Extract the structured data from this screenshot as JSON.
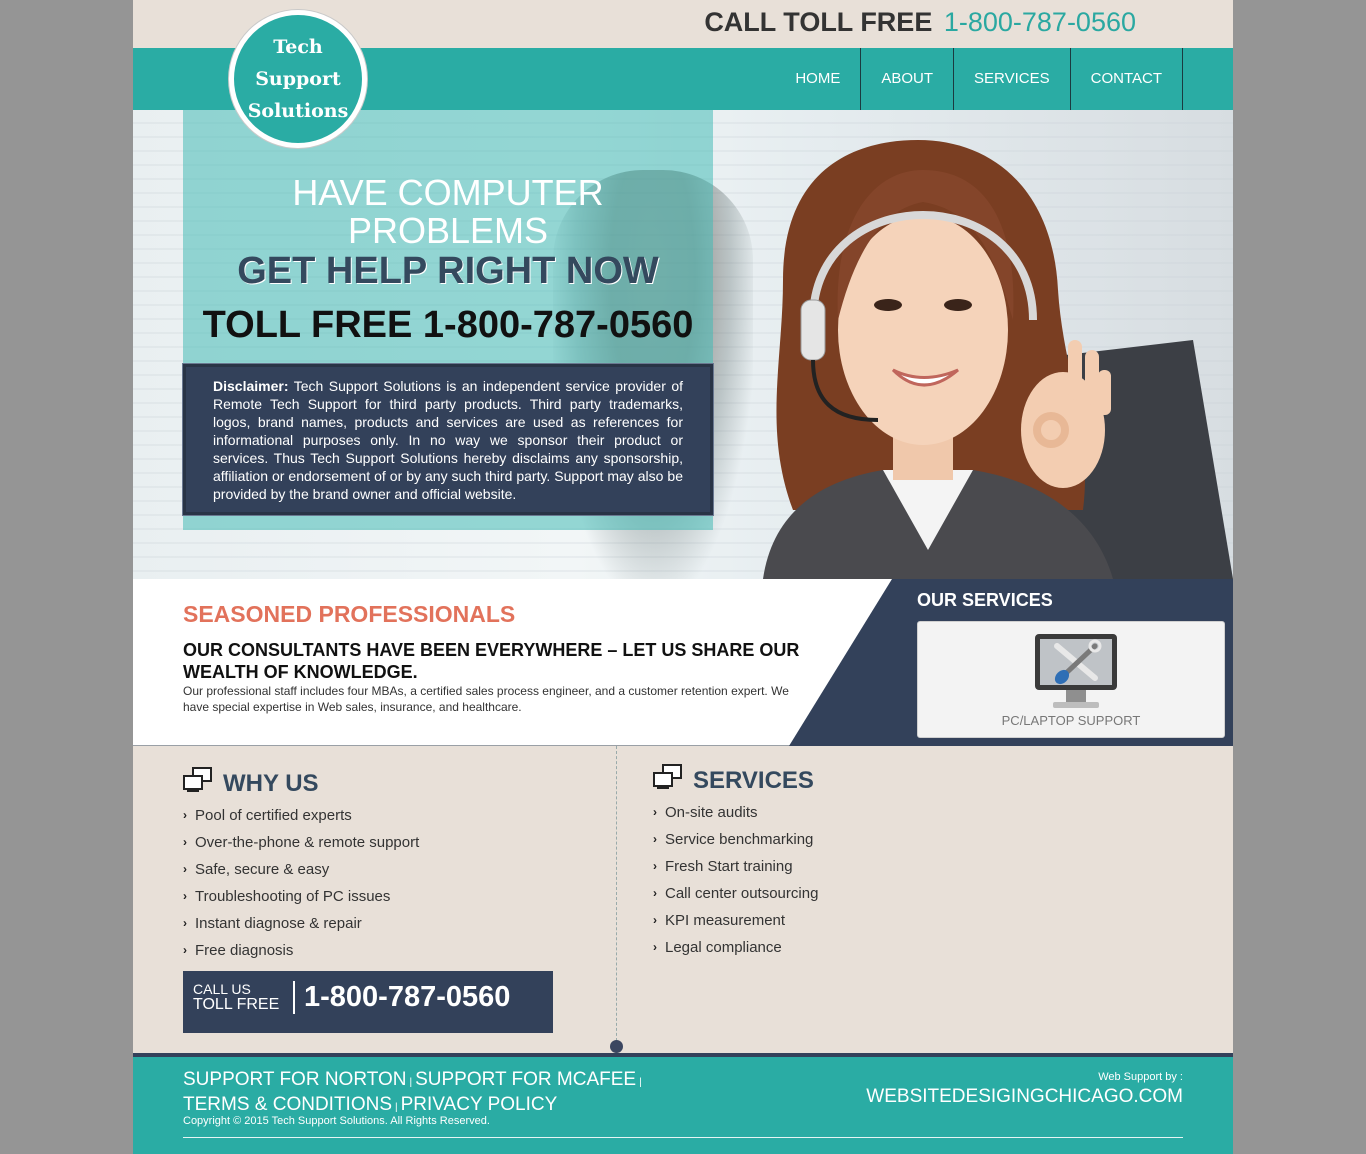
{
  "header": {
    "toll_label": "CALL TOLL FREE",
    "phone": "1-800-787-0560"
  },
  "logo": {
    "line1": "Tech",
    "line2": "Support",
    "line3": "Solutions"
  },
  "nav": {
    "items": [
      "HOME",
      "ABOUT",
      "SERVICES",
      "CONTACT"
    ]
  },
  "hero": {
    "headline1": "HAVE COMPUTER",
    "headline2": "PROBLEMS",
    "headline3": "GET HELP RIGHT NOW",
    "toll_line": "TOLL FREE 1-800-787-0560",
    "disclaimer_label": "Disclaimer:",
    "disclaimer_text": " Tech Support Solutions is an independent service provider of Remote Tech Support for third party products. Third party trademarks, logos, brand names, products and services are used as references for informational purposes only. In no way we sponsor their product or services. Thus Tech Support Solutions hereby disclaims any sponsorship, affiliation or endorsement of or by any such third party. Support may also be provided by the brand owner and official website."
  },
  "strip": {
    "heading": "SEASONED PROFESSIONALS",
    "subheading": "OUR CONSULTANTS HAVE BEEN EVERYWHERE – LET US SHARE OUR WEALTH OF KNOWLEDGE.",
    "paragraph": "Our professional staff includes four MBAs, a certified sales process engineer, and a customer retention expert. We have special expertise in Web sales, insurance, and healthcare.",
    "our_services_title": "OUR SERVICES",
    "service_item": "PC/LAPTOP SUPPORT"
  },
  "why_us": {
    "title": "WHY US",
    "items": [
      "Pool of certified experts",
      "Over-the-phone & remote support",
      "Safe, secure & easy",
      "Troubleshooting of PC issues",
      "Instant diagnose & repair",
      "Free diagnosis"
    ]
  },
  "services": {
    "title": "SERVICES",
    "items": [
      "On-site audits",
      "Service benchmarking",
      "Fresh Start training",
      "Call center outsourcing",
      "KPI measurement",
      "Legal compliance"
    ]
  },
  "callbox": {
    "line1": "CALL US",
    "line2": "TOLL FREE",
    "phone": "1-800-787-0560"
  },
  "footer": {
    "links": [
      "SUPPORT FOR NORTON",
      "SUPPORT FOR MCAFEE",
      "TERMS & CONDITIONS",
      "PRIVACY POLICY"
    ],
    "copyright": "Copyright © 2015 Tech Support Solutions. All Rights Reserved.",
    "web_support_label": "Web Support by :",
    "web_support_name": "WEBSITEDESIGINGCHICAGO.COM"
  },
  "colors": {
    "teal": "#2aaca4",
    "navy": "#33415a",
    "coral": "#e2725b",
    "beige": "#e8e0d8"
  }
}
